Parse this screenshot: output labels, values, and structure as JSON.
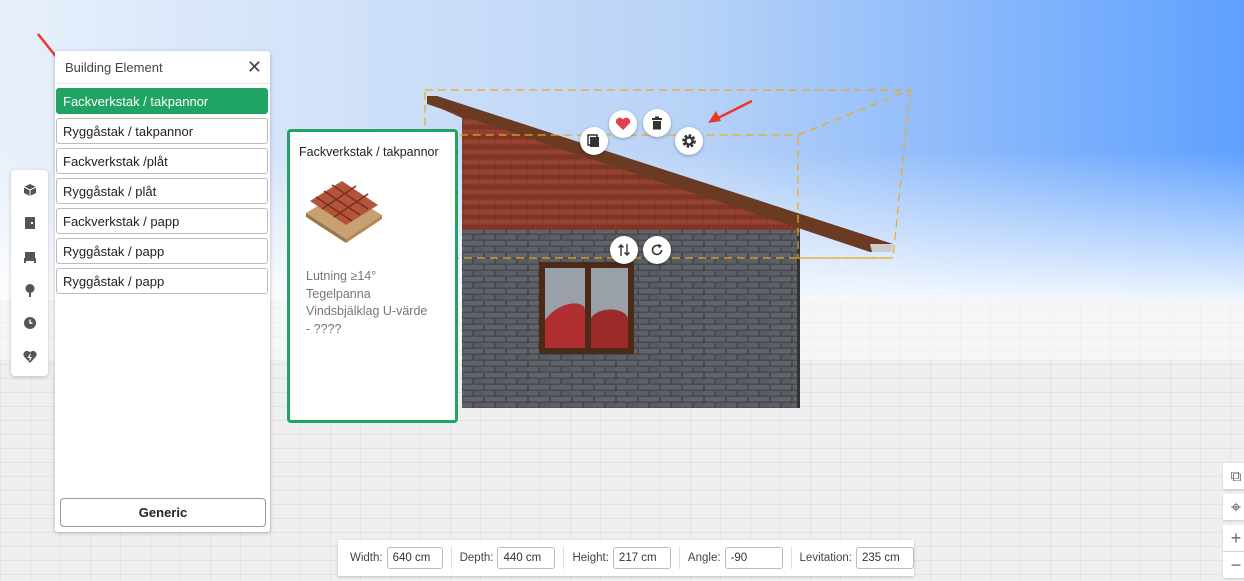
{
  "panel": {
    "title": "Building Element",
    "close_icon": "✕",
    "items": [
      {
        "label": "Fackverkstak / takpannor",
        "selected": true
      },
      {
        "label": "Ryggåstak / takpannor"
      },
      {
        "label": "Fackverkstak /plåt"
      },
      {
        "label": "Ryggåstak / plåt"
      },
      {
        "label": "Fackverkstak / papp"
      },
      {
        "label": "Ryggåstak / papp"
      },
      {
        "label": "Ryggåstak / papp"
      }
    ],
    "generic_label": "Generic"
  },
  "card": {
    "title": "Fackverkstak / takpannor",
    "description_lines": [
      "Lutning ≥14°",
      "Tegelpanna",
      "Vindsbjälklag U-värde",
      "- ????"
    ]
  },
  "toolbar": {
    "icons": [
      "cube-icon",
      "door-icon",
      "furniture-icon",
      "tree-icon",
      "clock-icon",
      "favorite-icon"
    ]
  },
  "dimensions": {
    "width_label": "Width:",
    "width_value": "640 cm",
    "depth_label": "Depth:",
    "depth_value": "440 cm",
    "height_label": "Height:",
    "height_value": "217 cm",
    "angle_label": "Angle:",
    "angle_value": "-90",
    "levitation_label": "Levitation:",
    "levitation_value": "235 cm"
  },
  "right_controls": {
    "external": "⧉",
    "locate": "⌖",
    "zoom_in": "+",
    "zoom_out": "−"
  },
  "colors": {
    "accent_green": "#1fa463",
    "favorite_red": "#e0424d",
    "arrow_red": "#e8392a",
    "sky_top": "#5ea0ff",
    "roof_brick": "#8a3a28",
    "wall_gray": "#5a5d63"
  }
}
